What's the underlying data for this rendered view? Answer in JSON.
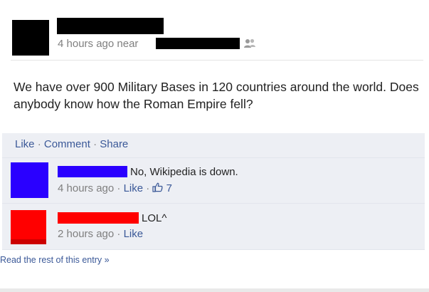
{
  "post": {
    "time_text": "4 hours ago near",
    "body": "We have over 900 Military Bases in 120 countries around the world. Does anybody know how the Roman Empire fell?",
    "actions": {
      "like": "Like",
      "comment": "Comment",
      "share": "Share",
      "separator": "·"
    }
  },
  "comments": [
    {
      "text": "No, Wikipedia is down.",
      "time": "4 hours ago",
      "like": "Like",
      "like_count": "7",
      "avatar_color": "#2a00ff"
    },
    {
      "text": "LOL^",
      "time": "2 hours ago",
      "like": "Like",
      "avatar_color": "#ff0000"
    }
  ],
  "footer": {
    "read_more": "Read the rest of this entry »"
  },
  "colors": {
    "link": "#3b5998",
    "meta": "#7f7f7f",
    "comment_bg": "#edeff4"
  }
}
